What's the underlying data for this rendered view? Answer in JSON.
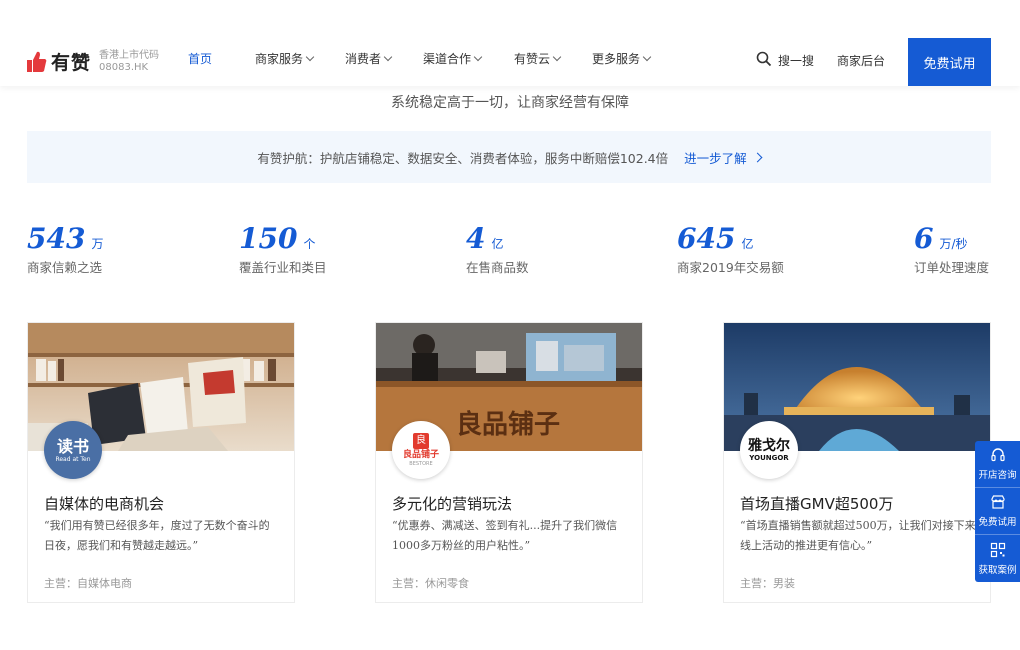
{
  "header": {
    "logo_text": "有赞",
    "logo_sub_line1": "香港上市代码",
    "logo_sub_line2": "08083.HK",
    "nav": [
      {
        "label": "首页",
        "active": true,
        "dropdown": false
      },
      {
        "label": "商家服务",
        "active": false,
        "dropdown": true
      },
      {
        "label": "消费者",
        "active": false,
        "dropdown": true
      },
      {
        "label": "渠道合作",
        "active": false,
        "dropdown": true
      },
      {
        "label": "有赞云",
        "active": false,
        "dropdown": true
      },
      {
        "label": "更多服务",
        "active": false,
        "dropdown": true
      }
    ],
    "search_label": "搜一搜",
    "backend_label": "商家后台",
    "trial_label": "免费试用"
  },
  "subtitle": "系统稳定高于一切，让商家经营有保障",
  "notice": {
    "text": "有赞护航：护航店铺稳定、数据安全、消费者体验，服务中断赔偿102.4倍",
    "link": "进一步了解"
  },
  "stats": [
    {
      "value": "543",
      "unit": "万",
      "label": "商家信赖之选"
    },
    {
      "value": "150",
      "unit": "个",
      "label": "覆盖行业和类目"
    },
    {
      "value": "4",
      "unit": "亿",
      "label": "在售商品数"
    },
    {
      "value": "645",
      "unit": "亿",
      "label": "商家2019年交易额"
    },
    {
      "value": "6",
      "unit": "万/秒",
      "label": "订单处理速度"
    }
  ],
  "cards": [
    {
      "logo_text": "读书",
      "logo_caption": "Read at Ten",
      "title": "自媒体的电商机会",
      "quote": "“我们用有赞已经很多年，度过了无数个奋斗的日夜，愿我们和有赞越走越远。”",
      "meta": "主营：自媒体电商"
    },
    {
      "logo_text": "良品铺子",
      "logo_caption": "BESTORE",
      "title": "多元化的营销玩法",
      "quote": "“优惠券、满减送、签到有礼...提升了我们微信1000多万粉丝的用户粘性。”",
      "meta": "主营：休闲零食"
    },
    {
      "logo_text": "雅戈尔",
      "logo_caption": "YOUNGOR",
      "title": "首场直播GMV超500万",
      "quote": "“首场直播销售额就超过500万，让我们对接下来线上活动的推进更有信心。”",
      "meta": "主营：男装"
    }
  ],
  "float_bar": [
    {
      "label": "开店咨询",
      "icon": "headset-icon"
    },
    {
      "label": "免费试用",
      "icon": "store-icon"
    },
    {
      "label": "获取案例",
      "icon": "qr-icon"
    }
  ],
  "colors": {
    "brand": "#155bd4",
    "logo_red": "#e4393c",
    "notice_bg": "#f2f7fd"
  }
}
